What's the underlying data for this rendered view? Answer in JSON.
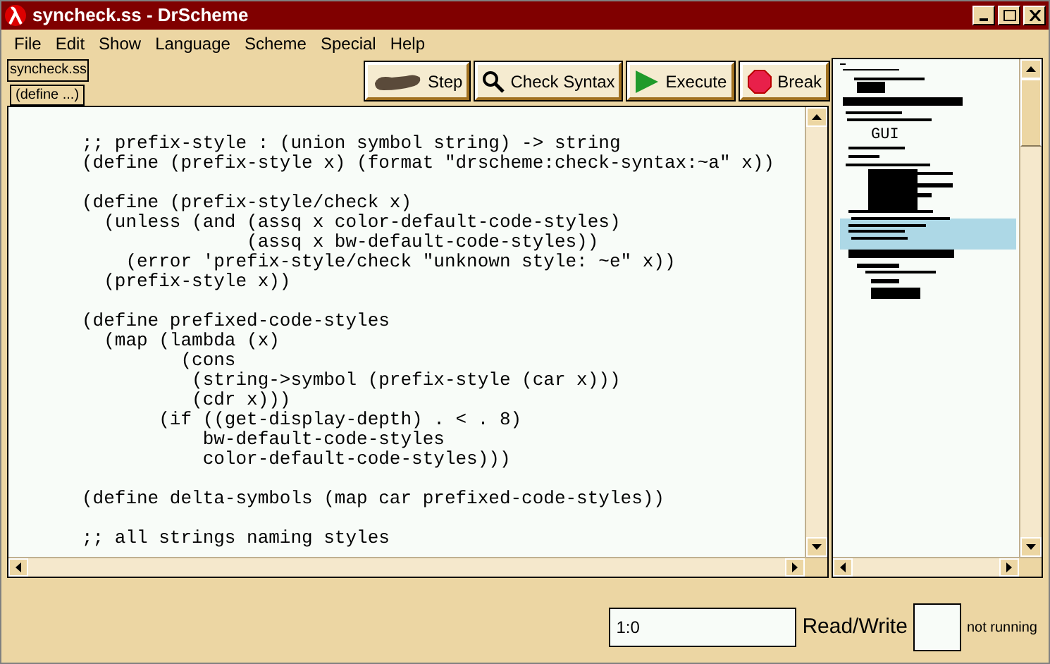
{
  "window": {
    "title": "syncheck.ss - DrScheme"
  },
  "menu": [
    "File",
    "Edit",
    "Show",
    "Language",
    "Scheme",
    "Special",
    "Help"
  ],
  "file_button": "syncheck.ss",
  "define_menu": "(define ...)",
  "toolbar": [
    {
      "kind": "step",
      "label": "Step"
    },
    {
      "kind": "check",
      "label": "Check Syntax"
    },
    {
      "kind": "execute",
      "label": "Execute"
    },
    {
      "kind": "break",
      "label": "Break"
    }
  ],
  "code_blocks": [
    [
      ";; prefix-style : (union symbol string) -> string",
      "(define (prefix-style x) (format \"drscheme:check-syntax:~a\" x))"
    ],
    [
      "(define (prefix-style/check x)",
      "  (unless (and (assq x color-default-code-styles)",
      "               (assq x bw-default-code-styles))",
      "    (error 'prefix-style/check \"unknown style: ~e\" x))",
      "  (prefix-style x))"
    ],
    [
      "(define prefixed-code-styles",
      "  (map (lambda (x)",
      "         (cons",
      "          (string->symbol (prefix-style (car x)))",
      "          (cdr x)))",
      "       (if ((get-display-depth) . < . 8)",
      "           bw-default-code-styles",
      "           color-default-code-styles)))"
    ],
    [
      "(define delta-symbols (map car prefixed-code-styles))"
    ],
    [
      ";; all strings naming styles"
    ]
  ],
  "minimap": {
    "heading": "GUI"
  },
  "status": {
    "position": "1:0",
    "mode": "Read/Write",
    "running": "not running"
  }
}
